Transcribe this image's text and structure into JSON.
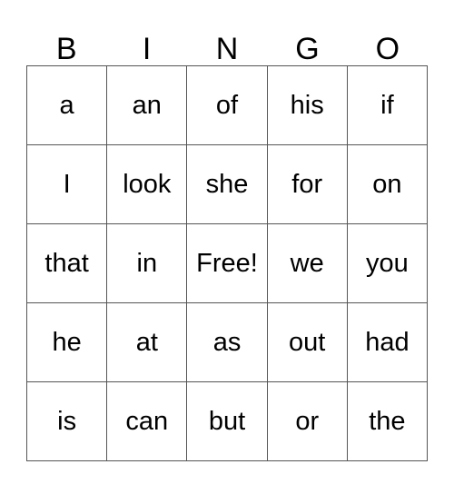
{
  "card": {
    "headers": [
      "B",
      "I",
      "N",
      "G",
      "O"
    ],
    "rows": [
      [
        "a",
        "an",
        "of",
        "his",
        "if"
      ],
      [
        "I",
        "look",
        "she",
        "for",
        "on"
      ],
      [
        "that",
        "in",
        "Free!",
        "we",
        "you"
      ],
      [
        "he",
        "at",
        "as",
        "out",
        "had"
      ],
      [
        "is",
        "can",
        "but",
        "or",
        "the"
      ]
    ],
    "colors": {
      "background": "#ffffff",
      "text": "#000000",
      "border": "#555555"
    }
  }
}
